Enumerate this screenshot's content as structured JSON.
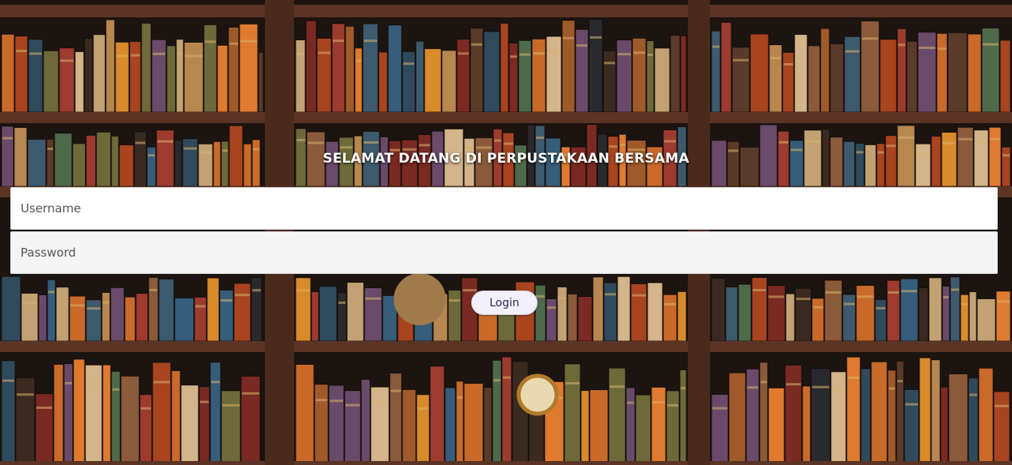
{
  "page": {
    "title": "SELAMAT DATANG DI PERPUSTAKAAN BERSAMA"
  },
  "form": {
    "username_placeholder": "Username",
    "password_placeholder": "Password",
    "login_label": "Login"
  },
  "colors": {
    "shelf_wood": "#4a2a1c",
    "title_text": "#ffffff",
    "button_bg": "#f2f0fa",
    "button_text": "#2b2b5a"
  },
  "background": {
    "description_icon": "bookshelf-background"
  }
}
